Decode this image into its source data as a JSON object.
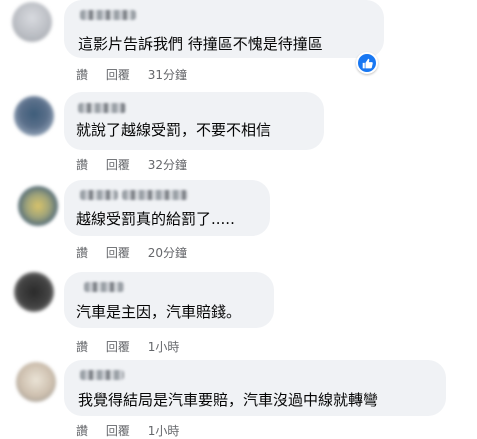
{
  "comments": [
    {
      "text": "這影片告訴我們 待撞區不愧是待撞區",
      "like": "讚",
      "reply": "回覆",
      "time": "31分鐘",
      "reaction": "like-icon"
    },
    {
      "text": "就說了越線受罰，不要不相信",
      "like": "讚",
      "reply": "回覆",
      "time": "32分鐘"
    },
    {
      "text": "越線受罰真的給罰了.....",
      "like": "讚",
      "reply": "回覆",
      "time": "20分鐘"
    },
    {
      "text": "汽車是主因，汽車賠錢。",
      "like": "讚",
      "reply": "回覆",
      "time": "1小時"
    },
    {
      "text": "我覺得結局是汽車要賠，汽車沒過中線就轉彎",
      "like": "讚",
      "reply": "回覆",
      "time": "1小時"
    }
  ],
  "colors": {
    "bubble": "#f0f2f5",
    "meta_text": "#65676b",
    "like_blue": "#1877f2"
  }
}
